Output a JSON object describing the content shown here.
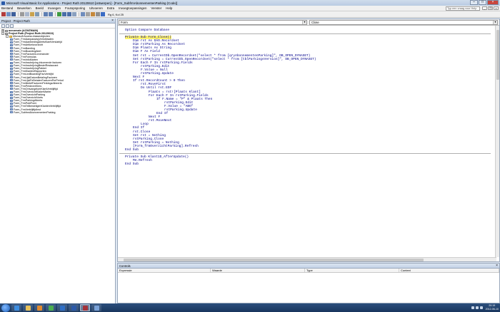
{
  "window": {
    "title": "Microsoft Visual Basic for Applications - Project Ruth 20120610 [ontwerpen] - [Form_SubfrmAbonnementenParking (Code)]"
  },
  "menu": {
    "items": [
      "Bestand",
      "Bewerken",
      "Beeld",
      "Invoegen",
      "Foutopsporing",
      "Uitvoeren",
      "Extra",
      "Invoegtoepassingen",
      "Venster",
      "Help"
    ],
    "help_placeholder": "Typ een vraag voor Help"
  },
  "toolbar": {
    "cursor_position": "Rg 6, Kol 25"
  },
  "project": {
    "title": "Project - Project Ruth",
    "tree": [
      {
        "label": "acrozmain (ACWZMAIN)",
        "level": 0,
        "expander": "+",
        "icon": "db",
        "bold": true
      },
      {
        "label": "Project Ruth (Project Ruth 20120610)",
        "level": 0,
        "expander": "-",
        "icon": "db",
        "bold": true
      },
      {
        "label": "Microsoft Access-klasseobjecten",
        "level": 1,
        "expander": "-",
        "icon": "folder",
        "bold": false
      },
      {
        "label": "Form_FrmAanpassingVerlofdraden",
        "level": 2,
        "expander": "",
        "icon": "form",
        "bold": false
      },
      {
        "label": "Form_FrmAanbiedingAlertsKlantVerslatrijd",
        "level": 2,
        "expander": "",
        "icon": "form",
        "bold": false
      },
      {
        "label": "Form_FrmArtikelvoorzicht",
        "level": 2,
        "expander": "",
        "icon": "form",
        "bold": false
      },
      {
        "label": "Form_FrmBanding",
        "level": 2,
        "expander": "",
        "icon": "form",
        "bold": false
      },
      {
        "label": "Form_FrmBoardingAlert",
        "level": 2,
        "expander": "",
        "icon": "form",
        "bold": false
      },
      {
        "label": "Form_FrmFacturenLeverancier",
        "level": 2,
        "expander": "",
        "icon": "form",
        "bold": false
      },
      {
        "label": "Form_FrmFormulas",
        "level": 2,
        "expander": "",
        "icon": "form",
        "bold": false
      },
      {
        "label": "Form_FrmInfoMarten",
        "level": 2,
        "expander": "",
        "icon": "form",
        "bold": false
      },
      {
        "label": "Form_FrmInschrijving inkomende facturen",
        "level": 2,
        "expander": "",
        "icon": "form",
        "bold": false
      },
      {
        "label": "Form_FrmInschrijvingBestelRestaurant",
        "level": 2,
        "expander": "",
        "icon": "form",
        "bold": false
      },
      {
        "label": "Form_FrmInschrijvingPakket",
        "level": 2,
        "expander": "",
        "icon": "form",
        "bold": false
      },
      {
        "label": "Form_FrmKlantenRapporten",
        "level": 2,
        "expander": "",
        "icon": "form",
        "bold": false
      },
      {
        "label": "Form_FrmLedBoardingFacVerblijfd",
        "level": 2,
        "expander": "",
        "icon": "form",
        "bold": false
      },
      {
        "label": "Form_FrmLijstDatumBetalingFacturen",
        "level": 2,
        "expander": "",
        "icon": "form",
        "bold": false
      },
      {
        "label": "Form_FrmLijstFeBetalenFacturenPerPeriod",
        "level": 2,
        "expander": "",
        "icon": "form",
        "bold": false
      },
      {
        "label": "Form_FrmNietefFacturenPerkingsAlbeerts",
        "level": 2,
        "expander": "",
        "icon": "form",
        "bold": false
      },
      {
        "label": "Form_FrmPeldeverKlers",
        "level": 2,
        "expander": "",
        "icon": "form",
        "bold": false
      },
      {
        "label": "Form_FrmOmvangeloerKlantVerblijftijd",
        "level": 2,
        "expander": "",
        "icon": "form",
        "bold": false
      },
      {
        "label": "Form_FrmOverzichtKlakerMarter",
        "level": 2,
        "expander": "",
        "icon": "form",
        "bold": false
      },
      {
        "label": "Form_FrmOverzichtParking",
        "level": 2,
        "expander": "",
        "icon": "form",
        "bold": false
      },
      {
        "label": "Form_FrmOverzichtVoets",
        "level": 2,
        "expander": "",
        "icon": "form",
        "bold": false
      },
      {
        "label": "Form_FrmParkingAlberts",
        "level": 2,
        "expander": "",
        "icon": "form",
        "bold": false
      },
      {
        "label": "Form_FrmPublForm",
        "level": 2,
        "expander": "",
        "icon": "form",
        "bold": false
      },
      {
        "label": "Form_FrmTellbesteligenKlantenVerblijftijd",
        "level": 2,
        "expander": "",
        "icon": "form",
        "bold": false
      },
      {
        "label": "Form_FrmVerblijftijdInst",
        "level": 2,
        "expander": "",
        "icon": "form",
        "bold": false
      },
      {
        "label": "Form_SubfrmAbonnementenParking",
        "level": 2,
        "expander": "",
        "icon": "form",
        "bold": false
      }
    ]
  },
  "code": {
    "object_combo": "Form",
    "procedure_combo": "Close",
    "option_line": "Option Compare Database",
    "lines": [
      {
        "text": "Private Sub Form_Close()",
        "indent": 0,
        "highlight": true
      },
      {
        "text": "Dim rst As DAO.Recordset",
        "indent": 1,
        "highlight": false
      },
      {
        "text": "Dim rstParking As Recordset",
        "indent": 1,
        "highlight": false
      },
      {
        "text": "Dim Plaats As String",
        "indent": 1,
        "highlight": false
      },
      {
        "text": "Dim F As Field",
        "indent": 1,
        "highlight": false
      },
      {
        "text": "Set rst = CurrentDb.OpenRecordset(\"select * from [qryAbonnementenParking]\", DB_OPEN_DYNASET)",
        "indent": 1,
        "highlight": false
      },
      {
        "text": "Set rstParking = CurrentDb.OpenRecordset(\"select * from [tblParkingsVersion]\", DB_OPEN_DYNASET)",
        "indent": 1,
        "highlight": false
      },
      {
        "text": "For Each F In rstParking.Fields",
        "indent": 1,
        "highlight": false
      },
      {
        "text": "rstParking.Edit",
        "indent": 2,
        "highlight": false
      },
      {
        "text": "F.Value = Null",
        "indent": 2,
        "highlight": false
      },
      {
        "text": "rstParking.Update",
        "indent": 2,
        "highlight": false
      },
      {
        "text": "Next F",
        "indent": 1,
        "highlight": false
      },
      {
        "text": "If rst.RecordCount > 0 Then",
        "indent": 1,
        "highlight": false
      },
      {
        "text": "rst.MoveFirst",
        "indent": 2,
        "highlight": false
      },
      {
        "text": "Do Until rst.EOF",
        "indent": 2,
        "highlight": false
      },
      {
        "text": "Plaats = rst![Plaats Klant]",
        "indent": 3,
        "highlight": false
      },
      {
        "text": "For Each F In rstParking.Fields",
        "indent": 3,
        "highlight": false
      },
      {
        "text": "If F.Name = \"P\" & Plaats Then",
        "indent": 4,
        "highlight": false
      },
      {
        "text": "rstParking.Edit",
        "indent": 5,
        "highlight": false
      },
      {
        "text": "F.Value = \"ABO\"",
        "indent": 5,
        "highlight": false
      },
      {
        "text": "rstParking.Update",
        "indent": 5,
        "highlight": false
      },
      {
        "text": "End If",
        "indent": 4,
        "highlight": false
      },
      {
        "text": "Next F",
        "indent": 3,
        "highlight": false
      },
      {
        "text": "rst.MoveNext",
        "indent": 3,
        "highlight": false
      },
      {
        "text": "Loop",
        "indent": 2,
        "highlight": false
      },
      {
        "text": "End If",
        "indent": 1,
        "highlight": false
      },
      {
        "text": "rst.Close",
        "indent": 1,
        "highlight": false
      },
      {
        "text": "Set rst = Nothing",
        "indent": 1,
        "highlight": false
      },
      {
        "text": "rstParking.Close",
        "indent": 1,
        "highlight": false
      },
      {
        "text": "Set rstParking = Nothing",
        "indent": 1,
        "highlight": false
      },
      {
        "text": "[Form_frmOverzichtParking].Refresh",
        "indent": 1,
        "highlight": false
      },
      {
        "text": "End Sub",
        "indent": 0,
        "highlight": false
      }
    ],
    "lines2": [
      {
        "text": "Private Sub Klant1D_AfterUpdate()",
        "indent": 0
      },
      {
        "text": "Me.Refresh",
        "indent": 1
      },
      {
        "text": "End Sub",
        "indent": 0
      }
    ]
  },
  "controls": {
    "title": "Controls",
    "columns": [
      "Expressie",
      "Waarde",
      "Type",
      "Context"
    ]
  },
  "taskbar": {
    "time": "20:19",
    "date": "2012-06-10"
  }
}
